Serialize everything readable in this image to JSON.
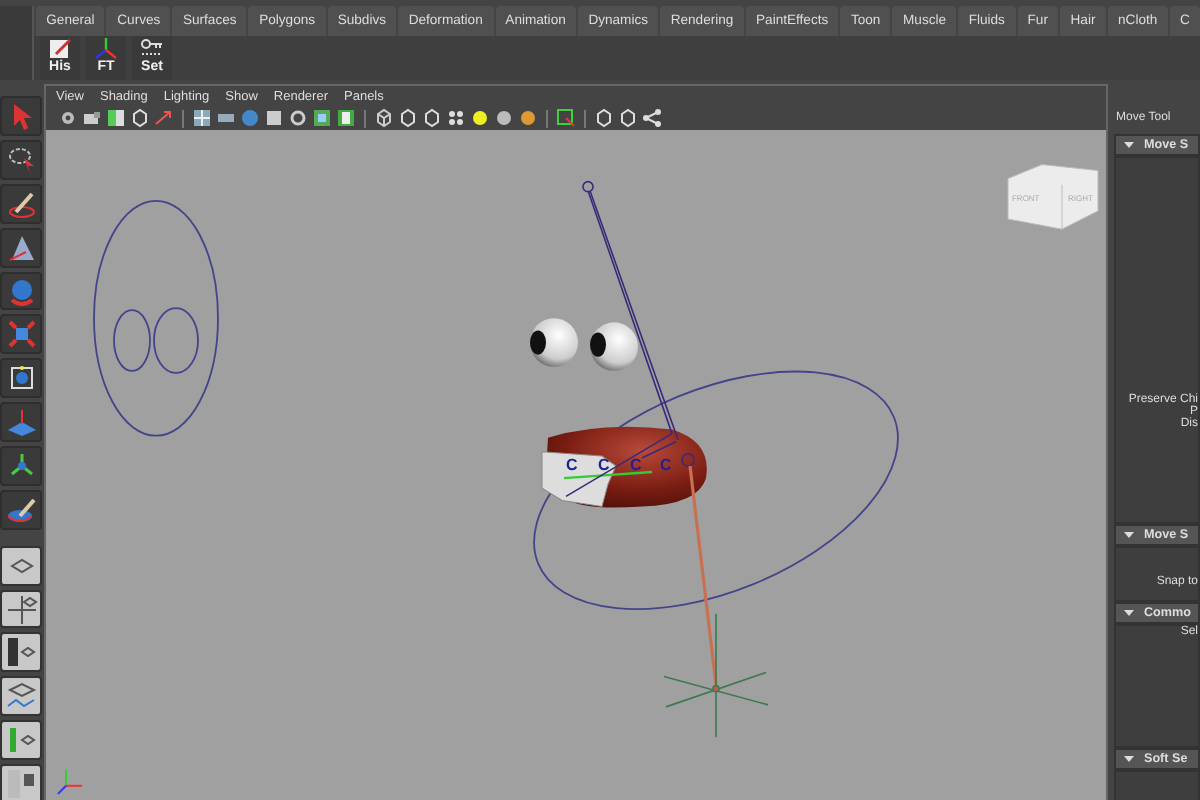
{
  "shelf": {
    "tabs": [
      {
        "label": "General",
        "selected": false
      },
      {
        "label": "Curves",
        "selected": false
      },
      {
        "label": "Surfaces",
        "selected": false
      },
      {
        "label": "Polygons",
        "selected": false
      },
      {
        "label": "Subdivs",
        "selected": false
      },
      {
        "label": "Deformation",
        "selected": false
      },
      {
        "label": "Animation",
        "selected": false
      },
      {
        "label": "Dynamics",
        "selected": false
      },
      {
        "label": "Rendering",
        "selected": false
      },
      {
        "label": "PaintEffects",
        "selected": false
      },
      {
        "label": "Toon",
        "selected": false
      },
      {
        "label": "Muscle",
        "selected": false
      },
      {
        "label": "Fluids",
        "selected": false
      },
      {
        "label": "Fur",
        "selected": false
      },
      {
        "label": "Hair",
        "selected": false
      },
      {
        "label": "nCloth",
        "selected": false
      },
      {
        "label": "C",
        "selected": false
      }
    ],
    "buttons": [
      {
        "label": "His",
        "kind": "note"
      },
      {
        "label": "FT",
        "kind": "axes"
      },
      {
        "label": "Set",
        "kind": "key"
      }
    ]
  },
  "viewport": {
    "menu": [
      "View",
      "Shading",
      "Lighting",
      "Show",
      "Renderer",
      "Panels"
    ],
    "view_cube": [
      "FRONT",
      "RIGHT"
    ],
    "cluster_handles": [
      "C",
      "C",
      "C",
      "C"
    ]
  },
  "attribute_editor": {
    "title": "Move Tool",
    "sections": [
      {
        "title": "Move S",
        "expanded": true,
        "lines": [
          "Preserve Chi",
          "P",
          "Dis"
        ]
      },
      {
        "title": "Move S",
        "expanded": true,
        "lines": [
          "Snap to"
        ]
      },
      {
        "title": "Commo",
        "expanded": true,
        "lines": [
          "Sel"
        ]
      },
      {
        "title": "Soft Se",
        "expanded": true
      }
    ]
  }
}
